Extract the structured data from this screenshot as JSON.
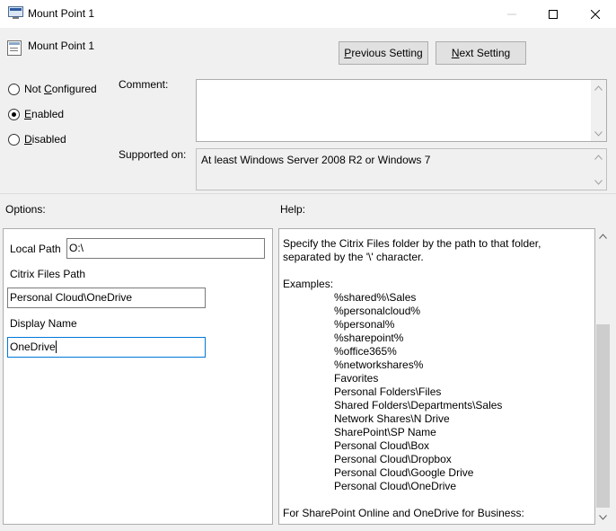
{
  "window": {
    "title": "Mount Point 1"
  },
  "header": {
    "title": "Mount Point 1"
  },
  "nav": {
    "previous_label": "Previous Setting",
    "previous_mnemonic": "P",
    "previous_rest": "revious Setting",
    "next_label": "Next Setting",
    "next_mnemonic": "N",
    "next_rest": "ext Setting"
  },
  "state": {
    "not_configured": {
      "mnemonic": "C",
      "pre": "Not ",
      "post": "onfigured"
    },
    "enabled": {
      "mnemonic": "E",
      "post": "nabled"
    },
    "disabled": {
      "mnemonic": "D",
      "post": "isabled"
    },
    "selected": "enabled"
  },
  "comment": {
    "label": "Comment:",
    "value": ""
  },
  "supported": {
    "label": "Supported on:",
    "value": "At least Windows Server 2008 R2 or Windows 7"
  },
  "options": {
    "label": "Options:",
    "local_path_label": "Local Path",
    "local_path_value": "O:\\",
    "citrix_path_label": "Citrix Files Path",
    "citrix_path_value": "Personal Cloud\\OneDrive",
    "display_name_label": "Display Name",
    "display_name_value": "OneDrive"
  },
  "help": {
    "label": "Help:",
    "intro": "Specify the Citrix Files folder by the path to that folder, separated by the '\\' character.",
    "examples_label": "Examples:",
    "examples": [
      "%shared%\\Sales",
      "%personalcloud%",
      "%personal%",
      "%sharepoint%",
      "%office365%",
      "%networkshares%",
      "Favorites",
      "Personal Folders\\Files",
      "Shared Folders\\Departments\\Sales",
      "Network Shares\\N Drive",
      "SharePoint\\SP Name",
      "Personal Cloud\\Box",
      "Personal Cloud\\Dropbox",
      "Personal Cloud\\Google Drive",
      "Personal Cloud\\OneDrive"
    ],
    "footer": "For SharePoint Online and OneDrive for Business:"
  }
}
